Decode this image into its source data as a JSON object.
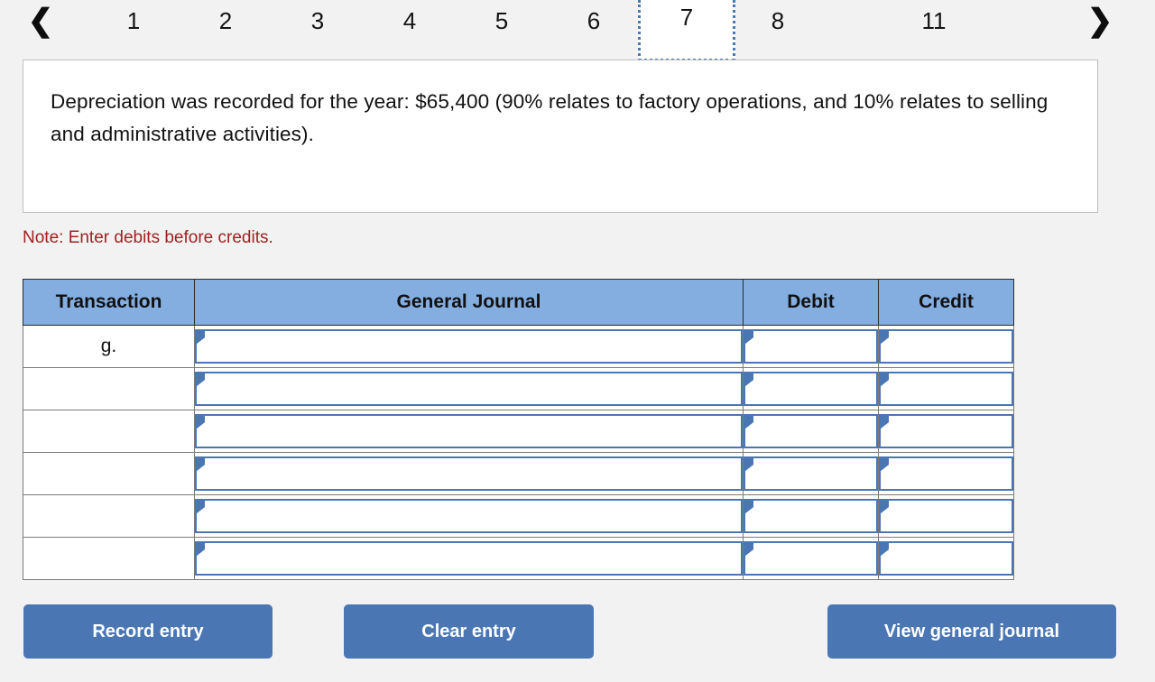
{
  "tabbar": {
    "prev_icon": "chevron-left-icon",
    "next_icon": "chevron-right-icon",
    "tabs": [
      {
        "label": "1",
        "selected": false
      },
      {
        "label": "2",
        "selected": false
      },
      {
        "label": "3",
        "selected": false
      },
      {
        "label": "4",
        "selected": false
      },
      {
        "label": "5",
        "selected": false
      },
      {
        "label": "6",
        "selected": false
      },
      {
        "label": "7",
        "selected": true
      },
      {
        "label": "8",
        "selected": false
      },
      {
        "label": "11",
        "selected": false
      }
    ],
    "selected_tab": "7"
  },
  "question": {
    "text": "Depreciation was recorded for the year: $65,400 (90% relates to factory operations, and 10% relates to selling and administrative activities)."
  },
  "note": {
    "text": "Note: Enter debits before credits."
  },
  "journal": {
    "headers": {
      "transaction": "Transaction",
      "general_journal": "General Journal",
      "debit": "Debit",
      "credit": "Credit"
    },
    "rows": [
      {
        "transaction": "g.",
        "general_journal": "",
        "debit": "",
        "credit": ""
      },
      {
        "transaction": "",
        "general_journal": "",
        "debit": "",
        "credit": ""
      },
      {
        "transaction": "",
        "general_journal": "",
        "debit": "",
        "credit": ""
      },
      {
        "transaction": "",
        "general_journal": "",
        "debit": "",
        "credit": ""
      },
      {
        "transaction": "",
        "general_journal": "",
        "debit": "",
        "credit": ""
      },
      {
        "transaction": "",
        "general_journal": "",
        "debit": "",
        "credit": ""
      }
    ]
  },
  "buttons": {
    "record_entry": "Record entry",
    "clear_entry": "Clear entry",
    "view_general_journal": "View general journal"
  },
  "colors": {
    "page_background": "#f2f2f2",
    "header_blue": "#85aee0",
    "accent_blue": "#4a77b4",
    "note_red": "#a02222"
  }
}
